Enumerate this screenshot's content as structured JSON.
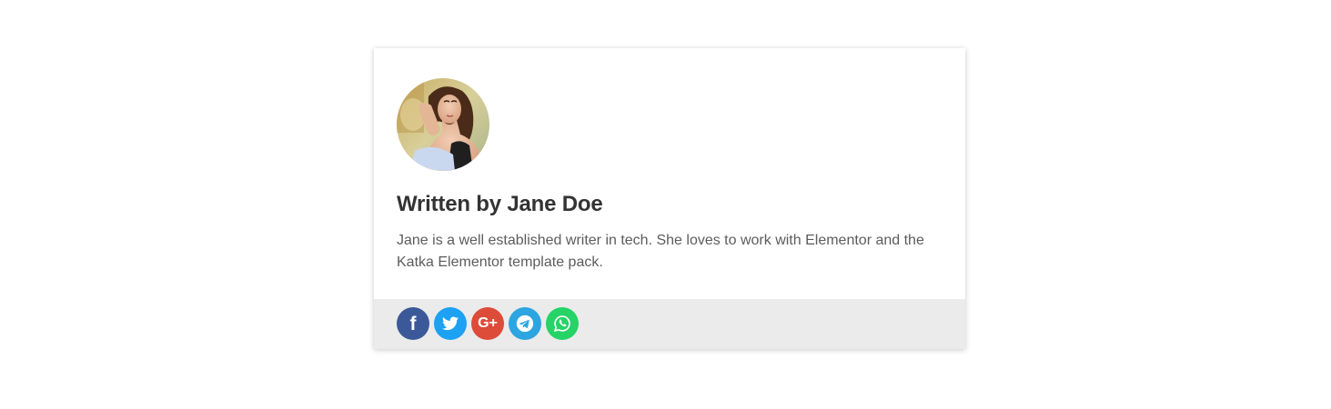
{
  "author_box": {
    "title": "Written by Jane Doe",
    "bio": "Jane is a well established writer in tech. She loves to work with Elementor and the Katka Elementor template pack.",
    "avatar_alt": "Jane Doe",
    "social": [
      {
        "name": "facebook",
        "icon": "facebook-icon",
        "color": "#3b5998",
        "glyph": "f"
      },
      {
        "name": "twitter",
        "icon": "twitter-icon",
        "color": "#1da1f2",
        "glyph": ""
      },
      {
        "name": "google-plus",
        "icon": "google-plus-icon",
        "color": "#dd4b39",
        "glyph": "G+"
      },
      {
        "name": "telegram",
        "icon": "telegram-icon",
        "color": "#2ca5e0",
        "glyph": ""
      },
      {
        "name": "whatsapp",
        "icon": "whatsapp-icon",
        "color": "#25d366",
        "glyph": ""
      }
    ],
    "colors": {
      "card_background": "#ffffff",
      "social_bar_background": "#ebebeb",
      "title_color": "#333333",
      "bio_color": "#5c5c5c"
    }
  }
}
